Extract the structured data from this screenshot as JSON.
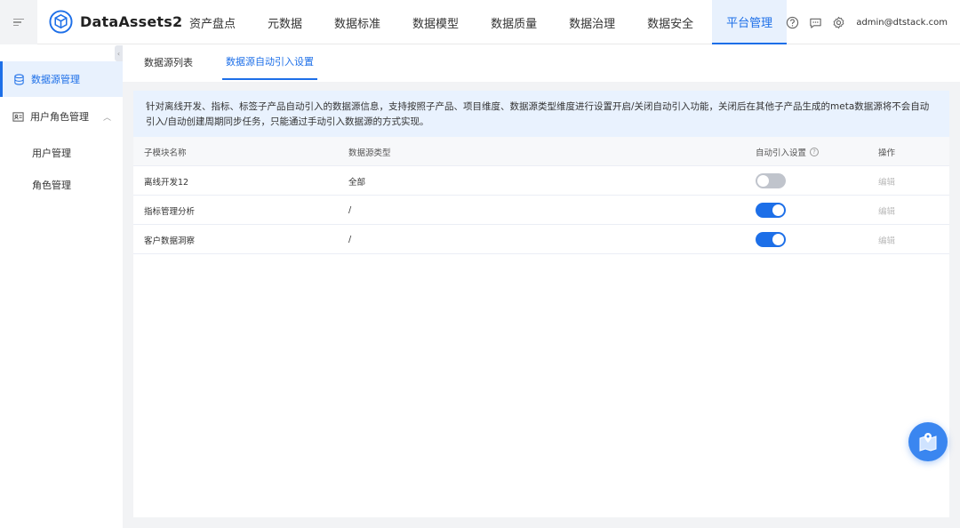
{
  "app": {
    "title": "DataAssets2"
  },
  "nav": {
    "items": [
      {
        "label": "资产盘点"
      },
      {
        "label": "元数据"
      },
      {
        "label": "数据标准"
      },
      {
        "label": "数据模型"
      },
      {
        "label": "数据质量"
      },
      {
        "label": "数据治理"
      },
      {
        "label": "数据安全"
      },
      {
        "label": "平台管理",
        "active": true
      }
    ]
  },
  "header": {
    "user": "admin@dtstack.com",
    "icons": [
      "help-icon",
      "message-icon",
      "settings-icon"
    ]
  },
  "sidebar": {
    "items": [
      {
        "label": "数据源管理",
        "icon": "database-icon",
        "active": true
      },
      {
        "label": "用户角色管理",
        "icon": "user-card-icon",
        "expanded": true
      }
    ],
    "sub_items": [
      {
        "label": "用户管理"
      },
      {
        "label": "角色管理"
      }
    ]
  },
  "tabs": [
    {
      "label": "数据源列表"
    },
    {
      "label": "数据源自动引入设置",
      "active": true
    }
  ],
  "notice": "针对离线开发、指标、标签子产品自动引入的数据源信息，支持按照子产品、项目维度、数据源类型维度进行设置开启/关闭自动引入功能，关闭后在其他子产品生成的meta数据源将不会自动引入/自动创建周期同步任务，只能通过手动引入数据源的方式实现。",
  "table": {
    "headers": {
      "name": "子模块名称",
      "type": "数据源类型",
      "auto": "自动引入设置",
      "action": "操作"
    },
    "rows": [
      {
        "name": "离线开发12",
        "type": "全部",
        "auto": false,
        "action": "编辑"
      },
      {
        "name": "指标管理分析",
        "type": "/",
        "auto": true,
        "action": "编辑"
      },
      {
        "name": "客户数据洞察",
        "type": "/",
        "auto": true,
        "action": "编辑"
      }
    ]
  },
  "colors": {
    "accent": "#1d6fe8",
    "active_bg": "#e8f1fd",
    "notice_bg": "#e9f2fe",
    "switch_off": "#c0c4cc"
  }
}
